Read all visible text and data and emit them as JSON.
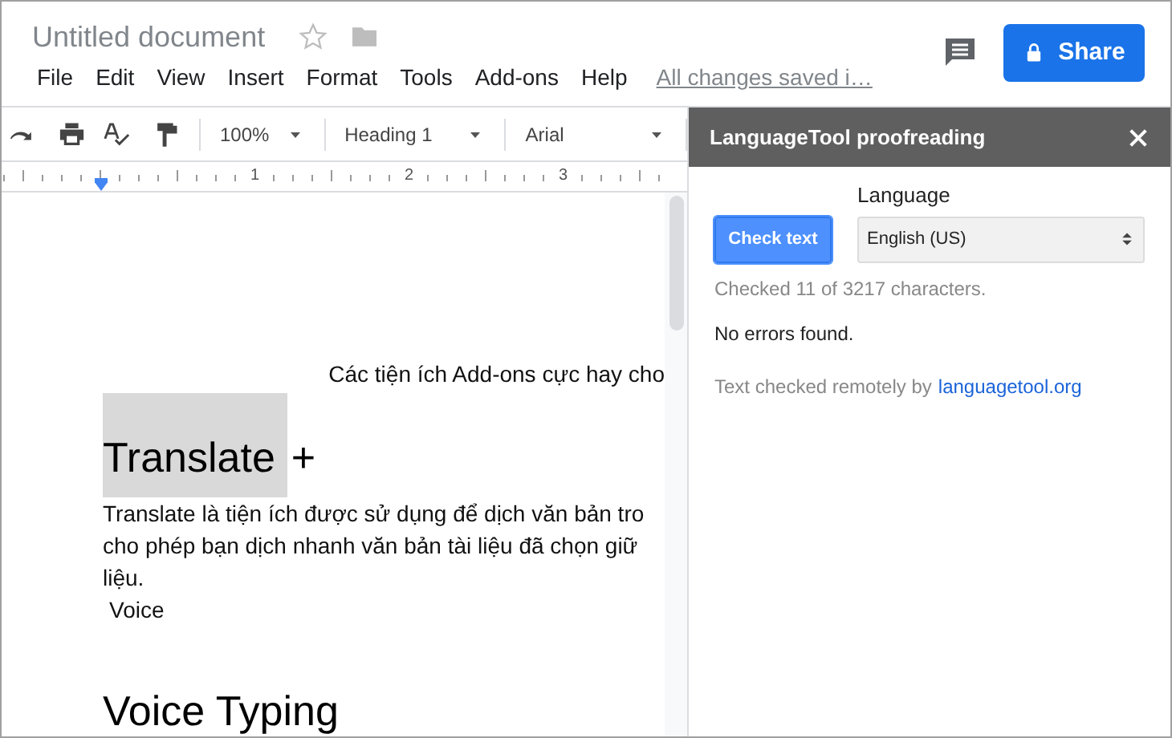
{
  "document": {
    "title": "Untitled document",
    "starred": false
  },
  "menu": [
    "File",
    "Edit",
    "View",
    "Insert",
    "Format",
    "Tools",
    "Add-ons",
    "Help"
  ],
  "save_status": "All changes saved i…",
  "share_button": "Share",
  "toolbar": {
    "zoom": "100%",
    "style": "Heading 1",
    "font": "Arial"
  },
  "ruler": {
    "marks": [
      "1",
      "2",
      "3"
    ]
  },
  "body": [
    {
      "kind": "caption",
      "text": "Các tiện ích Add-ons cực hay cho"
    },
    {
      "kind": "heading",
      "parts": [
        {
          "text": "Translate",
          "highlighted": true
        },
        {
          "text": "+",
          "highlighted": false
        }
      ]
    },
    {
      "kind": "paragraph",
      "lines": [
        "Translate là tiện ích được sử dụng để dịch văn bản tro",
        "cho phép bạn dịch nhanh văn bản tài liệu đã chọn giữ",
        "liệu."
      ]
    },
    {
      "kind": "line",
      "text": "Voice"
    },
    {
      "kind": "heading",
      "parts": [
        {
          "text": "Voice Typing",
          "highlighted": false
        }
      ]
    }
  ],
  "panel": {
    "title": "LanguageTool proofreading",
    "check_button": "Check text",
    "language_label": "Language",
    "language_value": "English (US)",
    "checked_info": "Checked 11 of 3217 characters.",
    "result": "No errors found.",
    "footer": "Text checked remotely by",
    "footer_link": "languagetool.org"
  }
}
